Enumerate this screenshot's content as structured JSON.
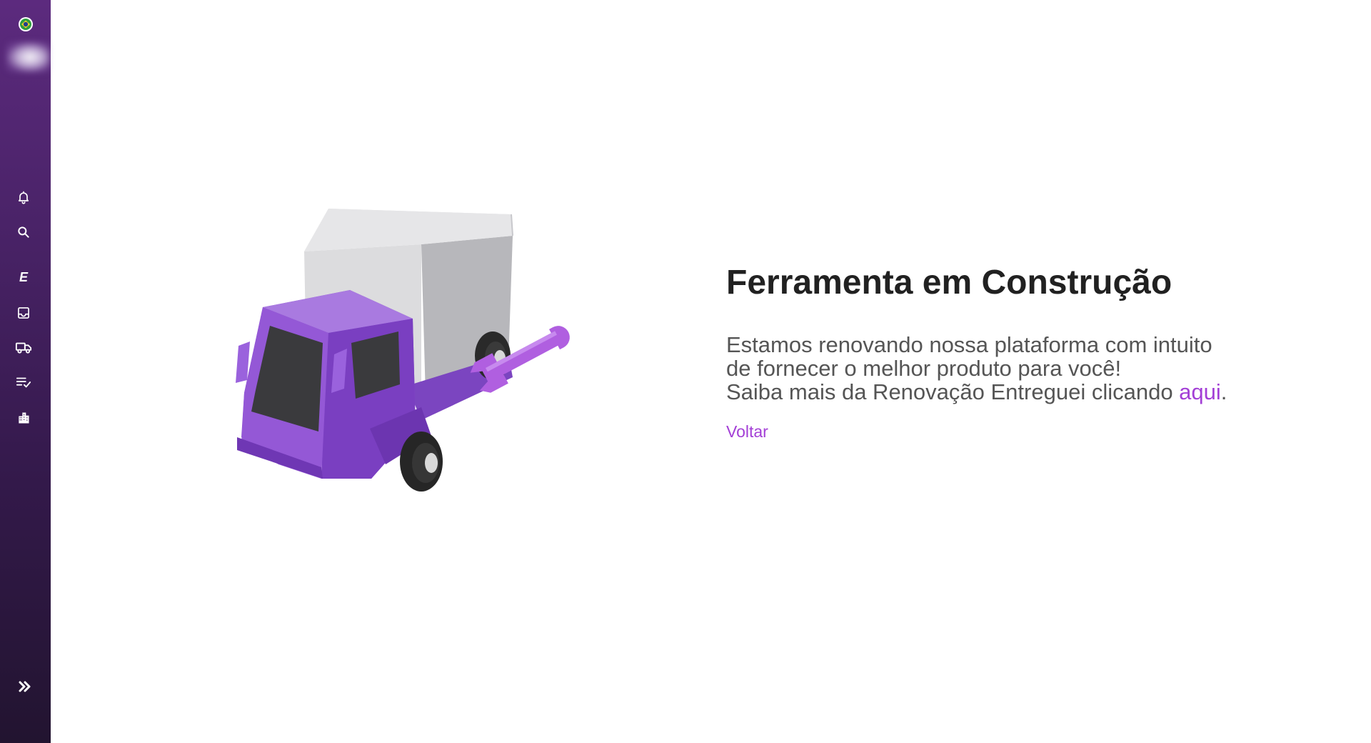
{
  "sidebar": {
    "flag": "brazil-flag-icon",
    "logo": "brand-logo",
    "items": [
      {
        "name": "notifications",
        "icon": "bell-icon"
      },
      {
        "name": "search",
        "icon": "search-icon"
      },
      {
        "name": "entregas-e",
        "icon": "e-letter-icon",
        "letter": "E"
      },
      {
        "name": "inbox",
        "icon": "inbox-icon"
      },
      {
        "name": "shipping",
        "icon": "truck-icon"
      },
      {
        "name": "checklist",
        "icon": "checklist-icon"
      },
      {
        "name": "company",
        "icon": "building-icon"
      }
    ],
    "expand_icon": "double-chevron-right-icon",
    "gradient_top": "#5c2a7e",
    "gradient_bottom": "#221430"
  },
  "main": {
    "illustration": "truck-under-repair-illustration",
    "title": "Ferramenta em Construção",
    "description_line1": "Estamos renovando nossa plataforma com intuito",
    "description_line2": "de fornecer o melhor produto para você!",
    "description_line3_prefix": "Saiba mais da Renovação Entreguei clicando ",
    "description_link": "aqui",
    "description_suffix": ".",
    "back_label": "Voltar"
  },
  "colors": {
    "accent": "#a33fd6",
    "title": "#212121",
    "text": "#555555",
    "truck_purple": "#8a4fd0"
  }
}
